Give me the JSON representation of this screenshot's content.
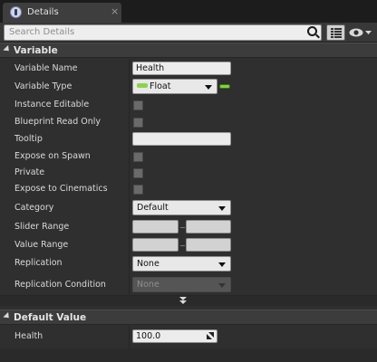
{
  "window": {
    "tab_title": "Details",
    "tab_close": "×"
  },
  "search": {
    "placeholder": "Search Details"
  },
  "sections": {
    "variable": {
      "title": "Variable",
      "rows": {
        "variable_name": {
          "label": "Variable Name",
          "value": "Health"
        },
        "variable_type": {
          "label": "Variable Type",
          "value": "Float"
        },
        "instance_editable": {
          "label": "Instance Editable",
          "checked": false
        },
        "blueprint_read_only": {
          "label": "Blueprint Read Only",
          "checked": false
        },
        "tooltip": {
          "label": "Tooltip",
          "value": ""
        },
        "expose_on_spawn": {
          "label": "Expose on Spawn",
          "checked": false
        },
        "private": {
          "label": "Private",
          "checked": false
        },
        "expose_to_cinematics": {
          "label": "Expose to Cinematics",
          "checked": false
        },
        "category": {
          "label": "Category",
          "value": "Default"
        },
        "slider_range": {
          "label": "Slider Range",
          "min": "",
          "max": ""
        },
        "value_range": {
          "label": "Value Range",
          "min": "",
          "max": ""
        },
        "replication": {
          "label": "Replication",
          "value": "None"
        },
        "replication_condition": {
          "label": "Replication Condition",
          "value": "None",
          "disabled": true
        }
      }
    },
    "default_value": {
      "title": "Default Value",
      "rows": {
        "health": {
          "label": "Health",
          "value": "100.0"
        }
      }
    }
  },
  "icons": {
    "tab": "details-icon",
    "search": "search-icon",
    "grid": "property-matrix-icon",
    "eye": "view-options-icon",
    "expand": "advanced-expand-icon",
    "resize": "expand-arrow-icon"
  },
  "colors": {
    "float_pin": "#8bd44a",
    "panel_bg": "#2f2f2f",
    "header_bg": "#3c3c3c"
  }
}
